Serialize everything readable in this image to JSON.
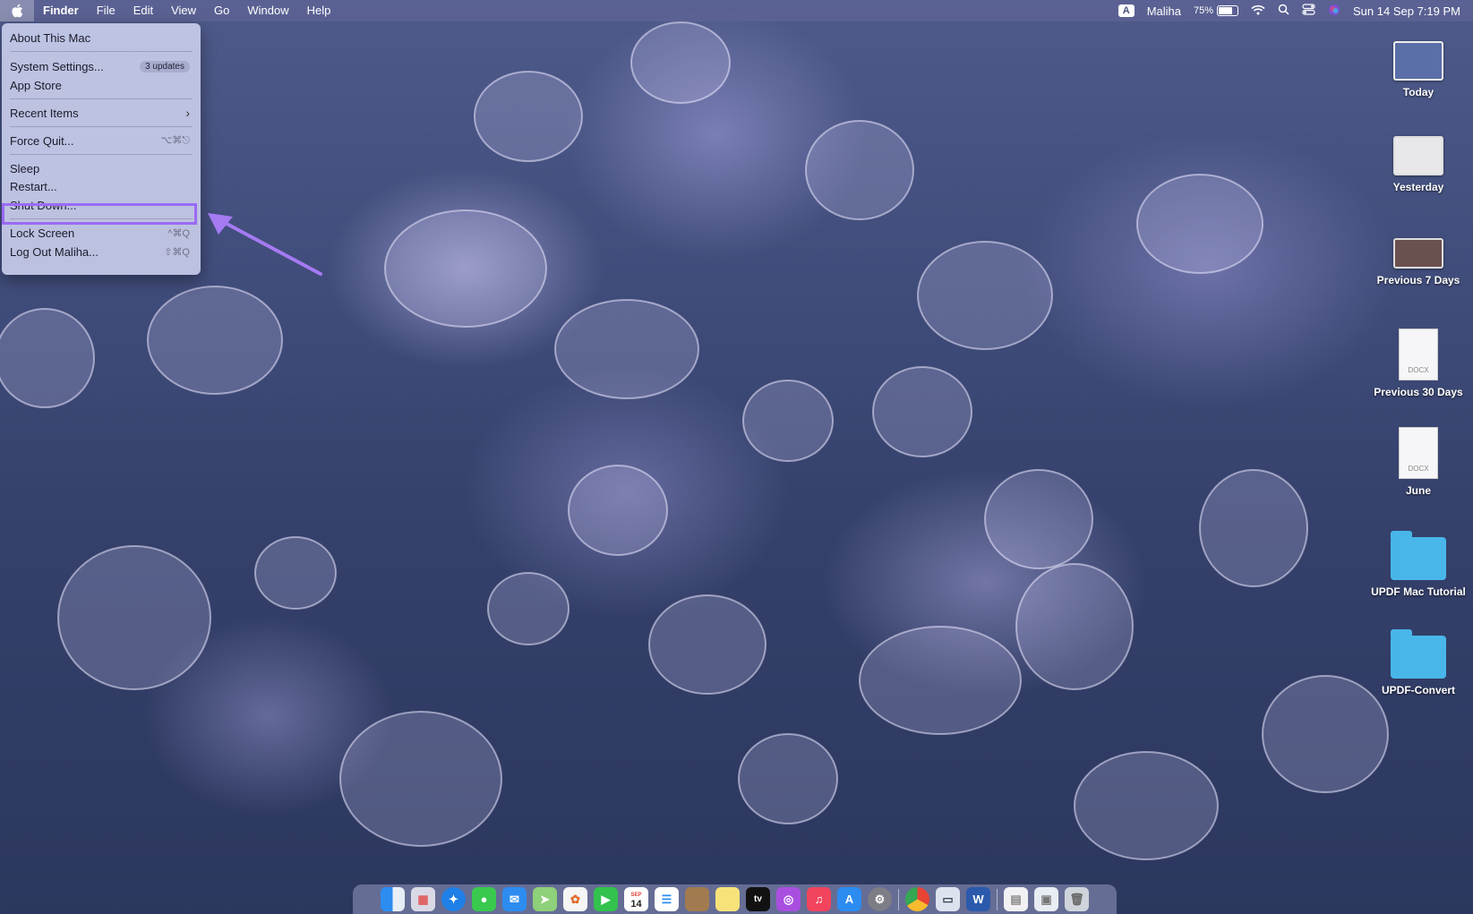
{
  "menubar": {
    "app_name": "Finder",
    "menus": [
      "File",
      "Edit",
      "View",
      "Go",
      "Window",
      "Help"
    ],
    "input_source": "A",
    "user": "Maliha",
    "battery_percent": "75%",
    "battery_level": 0.75,
    "datetime": "Sun 14 Sep  7:19 PM"
  },
  "apple_menu": {
    "about": "About This Mac",
    "system_settings": "System Settings...",
    "updates_badge": "3 updates",
    "app_store": "App Store",
    "recent_items": "Recent Items",
    "force_quit": "Force Quit...",
    "force_quit_shortcut": "⌥⌘⎋",
    "sleep": "Sleep",
    "restart": "Restart...",
    "shut_down": "Shut Down...",
    "lock_screen": "Lock Screen",
    "lock_screen_shortcut": "^⌘Q",
    "log_out": "Log Out Maliha...",
    "log_out_shortcut": "⇧⌘Q"
  },
  "annotation": {
    "highlight_color": "#9b6af5"
  },
  "desktop": {
    "items": [
      {
        "label": "Today",
        "kind": "screenshot"
      },
      {
        "label": "Yesterday",
        "kind": "screenshot"
      },
      {
        "label": "Previous 7 Days",
        "kind": "screenshot"
      },
      {
        "label": "Previous 30 Days",
        "kind": "docx",
        "tag": "DOCX"
      },
      {
        "label": "June",
        "kind": "docx",
        "tag": "DOCX"
      },
      {
        "label": "UPDF Mac Tutorial",
        "kind": "folder"
      },
      {
        "label": "UPDF-Convert",
        "kind": "folder"
      }
    ]
  },
  "dock": {
    "calendar_day": "14",
    "calendar_month": "SEP",
    "apps": [
      "Finder",
      "Launchpad",
      "Safari",
      "Messages",
      "Mail",
      "Maps",
      "Photos",
      "FaceTime",
      "Calendar",
      "Reminders",
      "Notes-brown",
      "Notes",
      "TV",
      "Podcasts",
      "Music",
      "App Store",
      "System Settings",
      "Chrome",
      "Preview",
      "Word",
      "Document",
      "Browser",
      "Trash"
    ]
  }
}
